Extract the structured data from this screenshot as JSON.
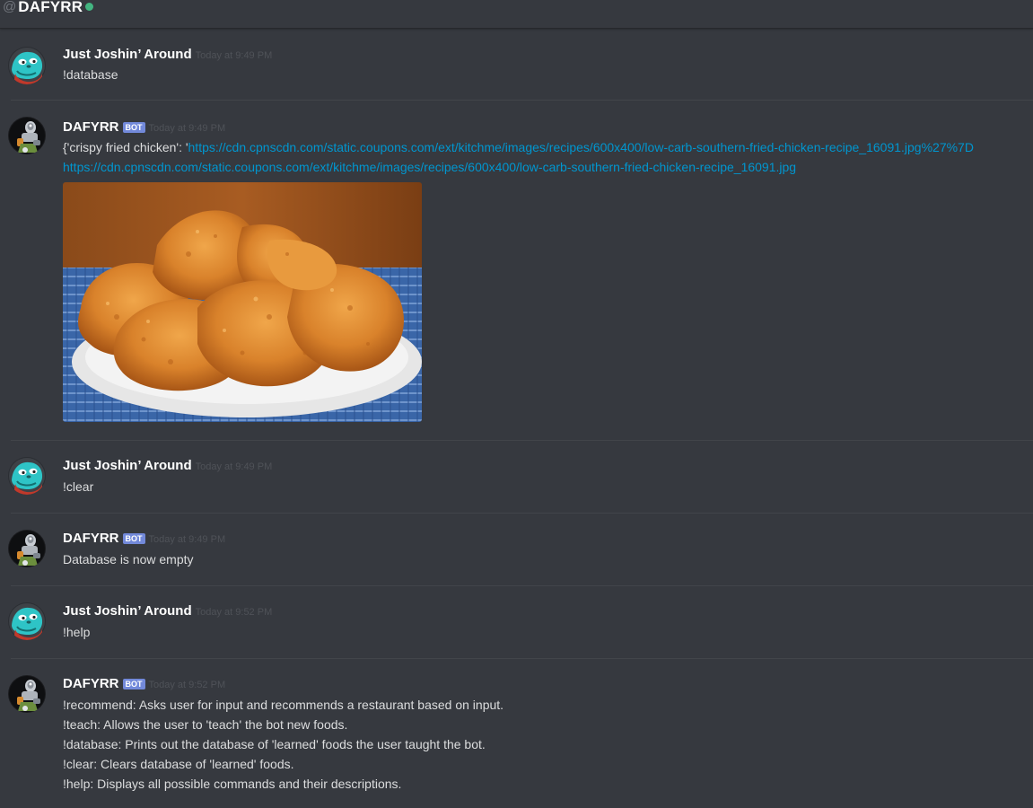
{
  "header": {
    "at_symbol": "@",
    "channel_name": "DAFYRR",
    "status": "online"
  },
  "messages": [
    {
      "author": "Just Joshin’ Around",
      "timestamp": "Today at 9:49 PM",
      "text": "!database"
    },
    {
      "author": "DAFYRR",
      "bot_tag": "BOT",
      "timestamp": "Today at 9:49 PM",
      "line1_prefix": "{'crispy fried chicken': '",
      "line1_link": "https://cdn.cpnscdn.com/static.coupons.com/ext/kitchme/images/recipes/600x400/low-carb-southern-fried-chicken-recipe_16091.jpg%27%7D",
      "line2_link": "https://cdn.cpnscdn.com/static.coupons.com/ext/kitchme/images/recipes/600x400/low-carb-southern-fried-chicken-recipe_16091.jpg",
      "attachment": "fried-chicken-image"
    },
    {
      "author": "Just Joshin’ Around",
      "timestamp": "Today at 9:49 PM",
      "text": "!clear"
    },
    {
      "author": "DAFYRR",
      "bot_tag": "BOT",
      "timestamp": "Today at 9:49 PM",
      "text": "Database is now empty"
    },
    {
      "author": "Just Joshin’ Around",
      "timestamp": "Today at 9:52 PM",
      "text": "!help"
    },
    {
      "author": "DAFYRR",
      "bot_tag": "BOT",
      "timestamp": "Today at 9:52 PM",
      "lines": [
        "!recommend: Asks user for input and recommends a restaurant based on input.",
        "!teach: Allows the user to 'teach' the bot new foods.",
        "!database: Prints out the database of 'learned' foods the user taught the bot.",
        "!clear: Clears database of 'learned' foods.",
        "!help: Displays all possible commands and their descriptions."
      ]
    }
  ],
  "colors": {
    "background": "#36393f",
    "text": "#dcddde",
    "username": "#ffffff",
    "timestamp": "#4f5258",
    "link": "#0096cf",
    "bot_tag": "#7289da",
    "online": "#43b581"
  }
}
